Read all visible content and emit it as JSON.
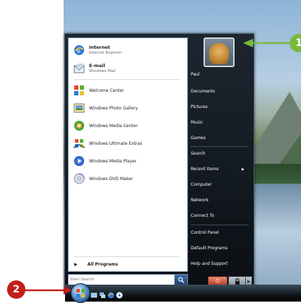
{
  "left_panel": {
    "pinned": [
      {
        "title": "Internet",
        "subtitle": "Internet Explorer"
      },
      {
        "title": "E-mail",
        "subtitle": "Windows Mail"
      }
    ],
    "recent": [
      "Welcome Center",
      "Windows Photo Gallery",
      "Windows Media Center",
      "Windows Ultimate Extras",
      "Windows Media Player",
      "Windows DVD Maker"
    ],
    "all_programs": "All Programs"
  },
  "search": {
    "placeholder": "Start Search"
  },
  "right_panel": {
    "items": [
      "Paul",
      "Documents",
      "Pictures",
      "Music",
      "Games",
      "Search",
      "Recent Items",
      "Computer",
      "Network",
      "Connect To",
      "Control Panel",
      "Default Programs",
      "Help and Support"
    ]
  },
  "callouts": {
    "one": "1",
    "two": "2"
  },
  "colors": {
    "callout_two": "#c0201a",
    "callout_one": "#7ab93a"
  }
}
